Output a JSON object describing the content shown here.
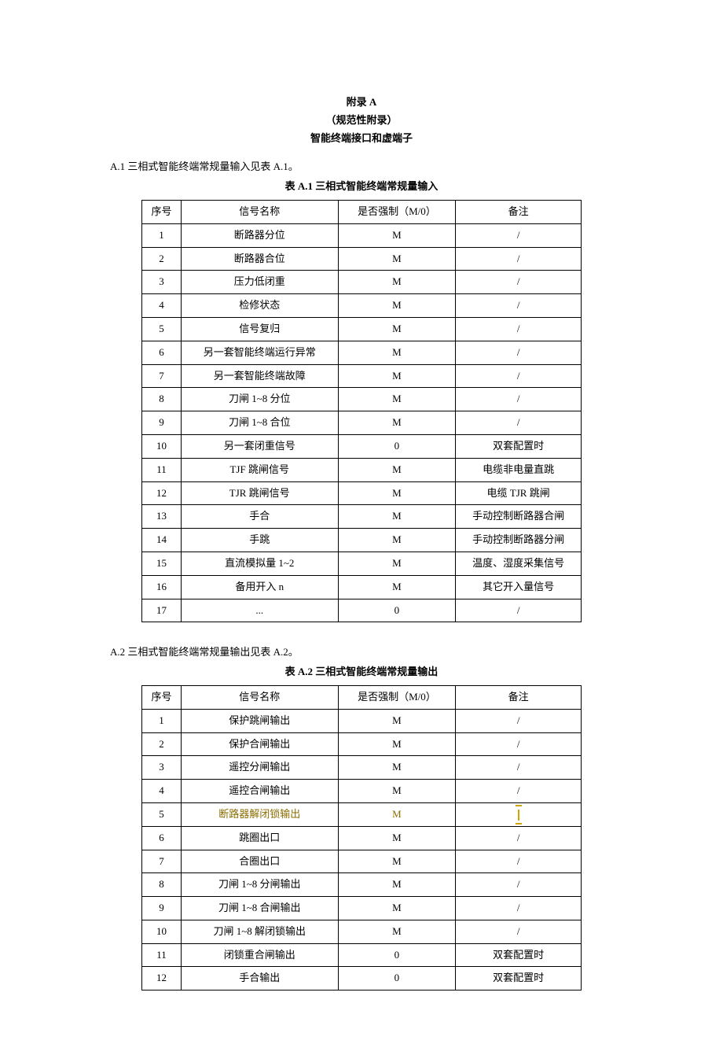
{
  "heading": {
    "appendix": "附录 A",
    "type": "（规范性附录）",
    "title": "智能终端接口和虚端子"
  },
  "section1": {
    "intro": "A.1 三相式智能终端常规量输入见表 A.1。",
    "caption": "表 A.1 三相式智能终端常规量输入"
  },
  "cols": {
    "c1": "序号",
    "c2": "信号名称",
    "c3": "是否强制（M/0）",
    "c4": "备注"
  },
  "t1": [
    {
      "n": "1",
      "name": "断路器分位",
      "m": "M",
      "r": "/"
    },
    {
      "n": "2",
      "name": "断路器合位",
      "m": "M",
      "r": "/"
    },
    {
      "n": "3",
      "name": "压力低闭重",
      "m": "M",
      "r": "/"
    },
    {
      "n": "4",
      "name": "检修状态",
      "m": "M",
      "r": "/"
    },
    {
      "n": "5",
      "name": "信号复归",
      "m": "M",
      "r": "/"
    },
    {
      "n": "6",
      "name": "另一套智能终端运行异常",
      "m": "M",
      "r": "/"
    },
    {
      "n": "7",
      "name": "另一套智能终端故障",
      "m": "M",
      "r": "/"
    },
    {
      "n": "8",
      "name": "刀闸 1~8 分位",
      "m": "M",
      "r": "/"
    },
    {
      "n": "9",
      "name": "刀闸 1~8 合位",
      "m": "M",
      "r": "/"
    },
    {
      "n": "10",
      "name": "另一套闭重信号",
      "m": "0",
      "r": "双套配置时"
    },
    {
      "n": "11",
      "name": "TJF 跳闸信号",
      "m": "M",
      "r": "电缆非电量直跳"
    },
    {
      "n": "12",
      "name": "TJR 跳闸信号",
      "m": "M",
      "r": "电缆 TJR 跳闸"
    },
    {
      "n": "13",
      "name": "手合",
      "m": "M",
      "r": "手动控制断路器合闸"
    },
    {
      "n": "14",
      "name": "手跳",
      "m": "M",
      "r": "手动控制断路器分闸"
    },
    {
      "n": "15",
      "name": "直流模拟量 1~2",
      "m": "M",
      "r": "温度、湿度采集信号"
    },
    {
      "n": "16",
      "name": "备用开入 n",
      "m": "M",
      "r": "其它开入量信号"
    },
    {
      "n": "17",
      "name": "...",
      "m": "0",
      "r": "/"
    }
  ],
  "section2": {
    "intro": "A.2 三相式智能终端常规量输出见表 A.2。",
    "caption": "表 A.2 三相式智能终端常规量输出"
  },
  "t2": [
    {
      "n": "1",
      "name": "保护跳闸输出",
      "m": "M",
      "r": "/"
    },
    {
      "n": "2",
      "name": "保护合闸输出",
      "m": "M",
      "r": "/"
    },
    {
      "n": "3",
      "name": "遥控分闸输出",
      "m": "M",
      "r": "/"
    },
    {
      "n": "4",
      "name": "遥控合闸输出",
      "m": "M",
      "r": "/"
    },
    {
      "n": "5",
      "name": "断路器解闭锁输出",
      "m": "M",
      "r": ""
    },
    {
      "n": "6",
      "name": "跳圈出口",
      "m": "M",
      "r": "/"
    },
    {
      "n": "7",
      "name": "合圈出口",
      "m": "M",
      "r": "/"
    },
    {
      "n": "8",
      "name": "刀闸 1~8 分闸输出",
      "m": "M",
      "r": "/"
    },
    {
      "n": "9",
      "name": "刀闸 1~8 合闸输出",
      "m": "M",
      "r": "/"
    },
    {
      "n": "10",
      "name": "刀闸 1~8 解闭锁输出",
      "m": "M",
      "r": "/"
    },
    {
      "n": "11",
      "name": "闭锁重合闸输出",
      "m": "0",
      "r": "双套配置时"
    },
    {
      "n": "12",
      "name": "手合输出",
      "m": "0",
      "r": "双套配置时"
    }
  ]
}
